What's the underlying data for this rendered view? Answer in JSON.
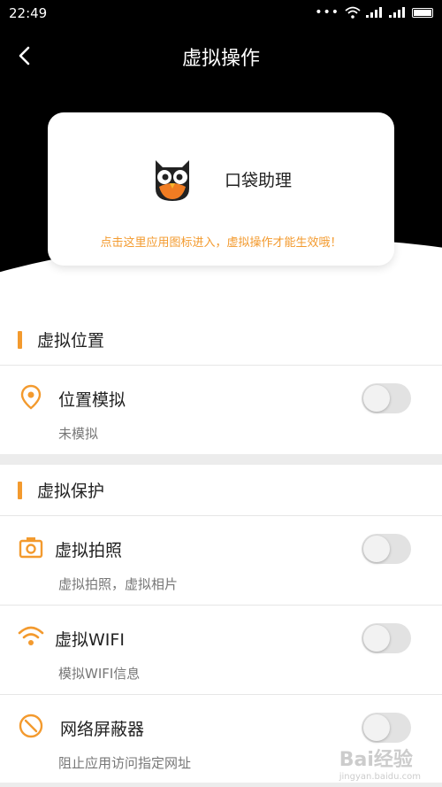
{
  "status_bar": {
    "time": "22:49",
    "dots": "•••"
  },
  "header": {
    "title": "虚拟操作",
    "back_icon": "chevron-left-icon"
  },
  "app_card": {
    "app_name": "口袋助理",
    "hint": "点击这里应用图标进入，虚拟操作才能生效哦！",
    "icon": "owl-app-icon"
  },
  "sections": {
    "location": {
      "title": "虚拟位置",
      "items": [
        {
          "label": "位置模拟",
          "sub": "未模拟",
          "icon": "location-pin-icon",
          "enabled": false
        }
      ]
    },
    "protection": {
      "title": "虚拟保护",
      "items": [
        {
          "label": "虚拟拍照",
          "sub": "虚拟拍照，虚拟相片",
          "icon": "camera-icon",
          "enabled": false
        },
        {
          "label": "虚拟WIFI",
          "sub": "模拟WIFI信息",
          "icon": "wifi-icon",
          "enabled": false
        },
        {
          "label": "网络屏蔽器",
          "sub": "阻止应用访问指定网址",
          "icon": "block-icon",
          "enabled": false
        }
      ]
    }
  },
  "watermark": {
    "brand": "Bai经验",
    "url": "jingyan.baidu.com"
  },
  "colors": {
    "accent": "#f39a2e",
    "header_bg": "#000000",
    "toggle_off": "#e2e2e2"
  }
}
